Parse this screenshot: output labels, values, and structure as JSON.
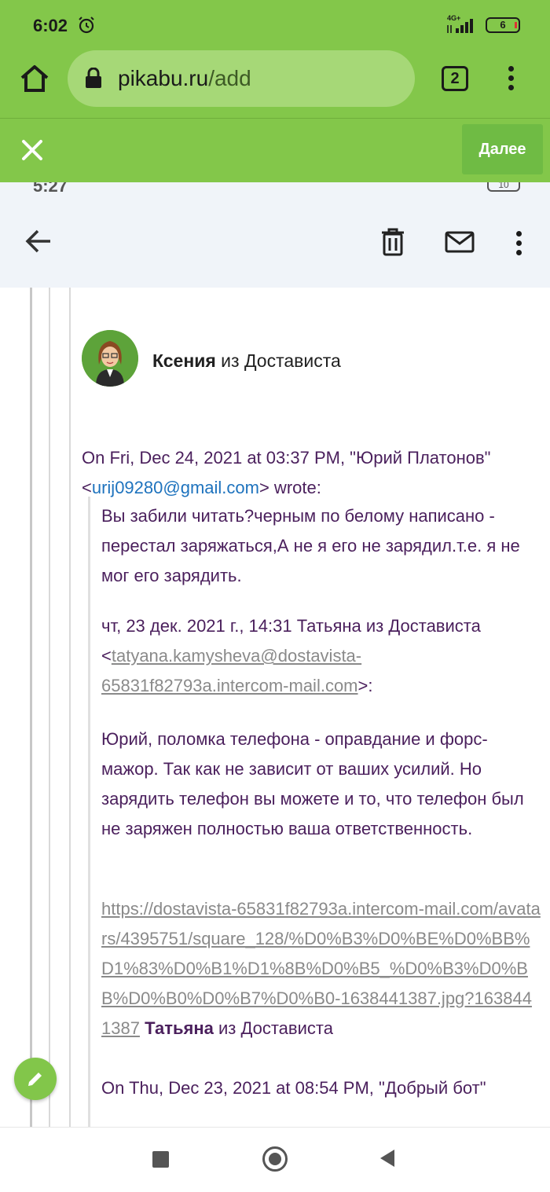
{
  "status_bar": {
    "time": "6:02",
    "network": "4G+",
    "battery": "6"
  },
  "browser": {
    "url_domain": "pikabu.ru",
    "url_path": "/add",
    "tab_count": "2",
    "next_label": "Далее",
    "accent_color": "#83c74a"
  },
  "mail_header": {
    "inner_time": "5:27",
    "inner_battery": "10"
  },
  "message": {
    "sender_name": "Ксения",
    "sender_org": " из Достависта",
    "intro_line1": "On Fri, Dec 24, 2021 at 03:37 PM, \"Юрий Платонов\"",
    "intro_email": "urij09280@gmail.com",
    "intro_tail": " wrote:",
    "reply_text": "Вы забили читать?черным по белому написано - перестал заряжаться,А не я его не зарядил.т.е. я не мог его зарядить.",
    "quote_header": "чт, 23 дек. 2021 г., 14:31 Татьяна из Достависта",
    "quote_email": "tatyana.kamysheva@dostavista-65831f82793a.intercom-mail.com",
    "quote_text": "Юрий, поломка телефона - оправдание и форс-мажор. Так как не зависит от ваших усилий. Но зарядить телефон вы можете и то, что телефон был не заряжен полностью ваша ответственность.",
    "avatar_link": "https://dostavista-65831f82793a.intercom-mail.com/avatars/4395751/square_128/%D0%B3%D0%BE%D0%BB%D1%83%D0%B1%D1%8B%D0%B5_%D0%B3%D0%BB%D0%B0%D0%B7%D0%B0-1638441387.jpg?1638441387",
    "signature_name": "Татьяна",
    "signature_org": " из Достависта",
    "next_quote": "On Thu, Dec 23, 2021 at 08:54 PM, \"Добрый бот\""
  }
}
